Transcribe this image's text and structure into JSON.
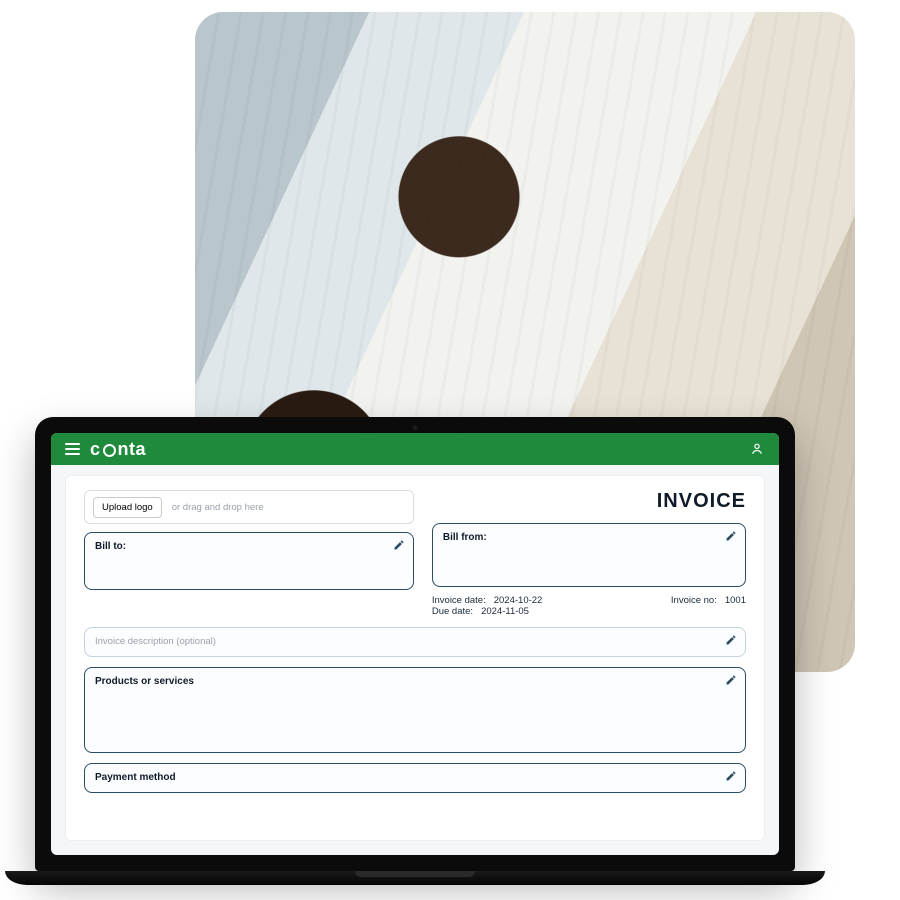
{
  "brand": {
    "name_left": "c",
    "name_right": "nta"
  },
  "header": {
    "title": "INVOICE"
  },
  "upload": {
    "button_label": "Upload logo",
    "hint": "or drag and drop here"
  },
  "bill_to": {
    "label": "Bill to:"
  },
  "bill_from": {
    "label": "Bill from:"
  },
  "dates": {
    "invoice_date_label": "Invoice date:",
    "invoice_date": "2024-10-22",
    "due_date_label": "Due date:",
    "due_date": "2024-11-05",
    "invoice_no_label": "Invoice no:",
    "invoice_no": "1001"
  },
  "description": {
    "placeholder": "Invoice description (optional)"
  },
  "products": {
    "label": "Products or services"
  },
  "payment": {
    "label": "Payment method"
  },
  "icons": {
    "pen": "pencil-icon",
    "user": "user-icon",
    "menu": "hamburger-icon"
  }
}
